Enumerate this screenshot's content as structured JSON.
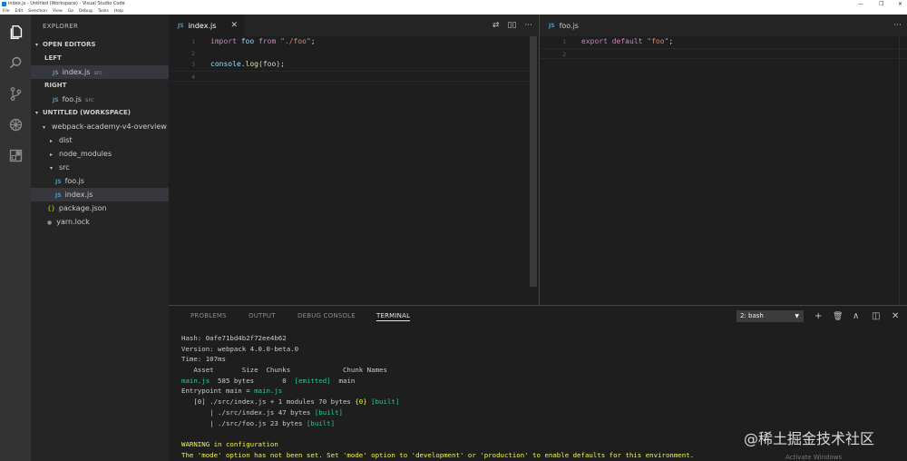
{
  "window": {
    "title": "index.js - Untitled (Workspace) - Visual Studio Code",
    "controls": [
      "—",
      "❐",
      "✕"
    ]
  },
  "menu": [
    "File",
    "Edit",
    "Selection",
    "View",
    "Go",
    "Debug",
    "Tasks",
    "Help"
  ],
  "activity": [
    "files-icon",
    "search-icon",
    "source-control-icon",
    "debug-icon",
    "extensions-icon"
  ],
  "sidebar": {
    "title": "EXPLORER",
    "open_editors": {
      "label": "OPEN EDITORS",
      "groups": [
        {
          "label": "LEFT",
          "items": [
            {
              "icon": "JS",
              "name": "index.js",
              "hint": "src"
            }
          ]
        },
        {
          "label": "RIGHT",
          "items": [
            {
              "icon": "JS",
              "name": "foo.js",
              "hint": "src"
            }
          ]
        }
      ]
    },
    "workspace": {
      "label": "UNTITLED (WORKSPACE)",
      "root": "webpack-academy-v4-overview",
      "items": [
        {
          "name": "dist"
        },
        {
          "name": "node_modules"
        },
        {
          "name": "src"
        },
        {
          "name": "foo.js",
          "icon": "JS"
        },
        {
          "name": "index.js",
          "icon": "JS"
        },
        {
          "name": "package.json",
          "icon": "{}"
        },
        {
          "name": "yarn.lock"
        }
      ]
    }
  },
  "editor_left": {
    "tab": {
      "icon": "JS",
      "label": "index.js",
      "close": "✕"
    },
    "actions": [
      "⇄",
      "▯▯",
      "···"
    ],
    "lines": [
      {
        "n": "1",
        "code": [
          "import",
          " foo ",
          "from",
          " \"./foo\"",
          ";"
        ]
      },
      {
        "n": "2",
        "code": [
          "",
          "",
          "",
          "",
          ""
        ]
      },
      {
        "n": "3",
        "code": [
          "console",
          ".",
          "log",
          "(foo);",
          ""
        ]
      },
      {
        "n": "4",
        "code": [
          "",
          "",
          "",
          "",
          ""
        ]
      }
    ]
  },
  "editor_right": {
    "tab": {
      "icon": "JS",
      "label": "foo.js"
    },
    "actions": [
      "···"
    ],
    "lines": [
      {
        "n": "1",
        "code": [
          "export",
          " ",
          "default",
          " \"foo\"",
          ";"
        ]
      },
      {
        "n": "2",
        "code": [
          "",
          "",
          "",
          "",
          ""
        ]
      }
    ]
  },
  "panel": {
    "tabs": [
      "PROBLEMS",
      "OUTPUT",
      "DEBUG CONSOLE",
      "TERMINAL"
    ],
    "terminal_select": "2: bash",
    "actions": [
      "+",
      "🗑",
      "∧",
      "◫",
      "✕"
    ],
    "terminal": {
      "hash": "Hash: 0afe71bd4b2f72ee4b62",
      "version": "Version: webpack 4.0.0-beta.0",
      "time": "Time: 107ms",
      "header": "   Asset       Size  Chunks             Chunk Names",
      "asset_name": "main.js",
      "asset_rest_1": "  585 bytes       0  ",
      "asset_emitted": "[emitted]",
      "asset_rest_2": "  main",
      "entry_prefix": "Entrypoint main = ",
      "entry_file": "main.js",
      "mod1_prefix": "   [0] ./src/index.js + 1 modules 70 bytes ",
      "mod1_chunk": "{0}",
      "mod1_built": " [built]",
      "mod2_prefix": "       | ./src/index.js 47 bytes ",
      "mod2_built": "[built]",
      "mod3_prefix": "       | ./src/foo.js 23 bytes ",
      "mod3_built": "[built]",
      "warning_title": "WARNING in configuration",
      "warning_text": "The 'mode' option has not been set. Set 'mode' option to 'development' or 'production' to enable defaults for this environment."
    }
  },
  "watermark": "@稀土掘金技术社区",
  "activate_windows": "Activate Windows",
  "colors": {
    "activity_bar": "#333333",
    "sidebar": "#252526",
    "editor": "#1e1e1e",
    "js_icon": "#519aba",
    "keyword": "#c586c0",
    "string": "#ce9178",
    "terminal_green": "#23d18b",
    "terminal_yellow": "#f5f543"
  }
}
